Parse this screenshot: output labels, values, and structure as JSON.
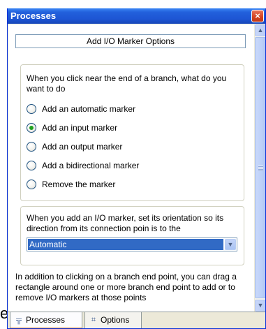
{
  "clip_text": "e",
  "window": {
    "title": "Processes",
    "close_glyph": "×"
  },
  "header": {
    "title": "Add I/O Marker Options"
  },
  "branch_group": {
    "prompt": "When you click near the end of a branch, what do you want to do",
    "options": [
      {
        "label": "Add an automatic marker",
        "selected": false
      },
      {
        "label": "Add an input marker",
        "selected": true
      },
      {
        "label": "Add an output marker",
        "selected": false
      },
      {
        "label": "Add a bidirectional marker",
        "selected": false
      },
      {
        "label": "Remove the marker",
        "selected": false
      }
    ]
  },
  "orientation_group": {
    "prompt": "When you add an I/O marker, set its orientation so its direction from its connection poin is to the",
    "select_value": "Automatic",
    "select_icon": "chevron-down-icon"
  },
  "info": {
    "text": "In addition to clicking on a branch end point, you can drag a rectangle around one or more branch end point to add or to remove I/O markers at those points"
  },
  "scrollbar": {
    "up_icon": "scroll-up-icon",
    "down_icon": "scroll-down-icon"
  },
  "tabs": [
    {
      "label": "Processes",
      "icon": "processes-tree-icon",
      "active": true
    },
    {
      "label": "Options",
      "icon": "options-icon",
      "active": false
    }
  ],
  "colors": {
    "titlebar": "#2260dc",
    "selection": "#316ac5",
    "radio_selected": "#21a121",
    "close_button": "#d34220",
    "active_tab_accent": "#e68b2c"
  }
}
